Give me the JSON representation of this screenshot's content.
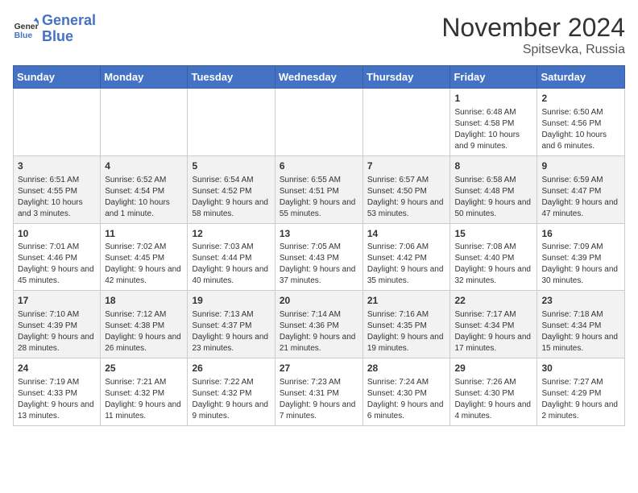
{
  "logo": {
    "general": "General",
    "blue": "Blue"
  },
  "header": {
    "month": "November 2024",
    "location": "Spitsevka, Russia"
  },
  "weekdays": [
    "Sunday",
    "Monday",
    "Tuesday",
    "Wednesday",
    "Thursday",
    "Friday",
    "Saturday"
  ],
  "rows": [
    [
      {
        "day": "",
        "info": ""
      },
      {
        "day": "",
        "info": ""
      },
      {
        "day": "",
        "info": ""
      },
      {
        "day": "",
        "info": ""
      },
      {
        "day": "",
        "info": ""
      },
      {
        "day": "1",
        "info": "Sunrise: 6:48 AM\nSunset: 4:58 PM\nDaylight: 10 hours and 9 minutes."
      },
      {
        "day": "2",
        "info": "Sunrise: 6:50 AM\nSunset: 4:56 PM\nDaylight: 10 hours and 6 minutes."
      }
    ],
    [
      {
        "day": "3",
        "info": "Sunrise: 6:51 AM\nSunset: 4:55 PM\nDaylight: 10 hours and 3 minutes."
      },
      {
        "day": "4",
        "info": "Sunrise: 6:52 AM\nSunset: 4:54 PM\nDaylight: 10 hours and 1 minute."
      },
      {
        "day": "5",
        "info": "Sunrise: 6:54 AM\nSunset: 4:52 PM\nDaylight: 9 hours and 58 minutes."
      },
      {
        "day": "6",
        "info": "Sunrise: 6:55 AM\nSunset: 4:51 PM\nDaylight: 9 hours and 55 minutes."
      },
      {
        "day": "7",
        "info": "Sunrise: 6:57 AM\nSunset: 4:50 PM\nDaylight: 9 hours and 53 minutes."
      },
      {
        "day": "8",
        "info": "Sunrise: 6:58 AM\nSunset: 4:48 PM\nDaylight: 9 hours and 50 minutes."
      },
      {
        "day": "9",
        "info": "Sunrise: 6:59 AM\nSunset: 4:47 PM\nDaylight: 9 hours and 47 minutes."
      }
    ],
    [
      {
        "day": "10",
        "info": "Sunrise: 7:01 AM\nSunset: 4:46 PM\nDaylight: 9 hours and 45 minutes."
      },
      {
        "day": "11",
        "info": "Sunrise: 7:02 AM\nSunset: 4:45 PM\nDaylight: 9 hours and 42 minutes."
      },
      {
        "day": "12",
        "info": "Sunrise: 7:03 AM\nSunset: 4:44 PM\nDaylight: 9 hours and 40 minutes."
      },
      {
        "day": "13",
        "info": "Sunrise: 7:05 AM\nSunset: 4:43 PM\nDaylight: 9 hours and 37 minutes."
      },
      {
        "day": "14",
        "info": "Sunrise: 7:06 AM\nSunset: 4:42 PM\nDaylight: 9 hours and 35 minutes."
      },
      {
        "day": "15",
        "info": "Sunrise: 7:08 AM\nSunset: 4:40 PM\nDaylight: 9 hours and 32 minutes."
      },
      {
        "day": "16",
        "info": "Sunrise: 7:09 AM\nSunset: 4:39 PM\nDaylight: 9 hours and 30 minutes."
      }
    ],
    [
      {
        "day": "17",
        "info": "Sunrise: 7:10 AM\nSunset: 4:39 PM\nDaylight: 9 hours and 28 minutes."
      },
      {
        "day": "18",
        "info": "Sunrise: 7:12 AM\nSunset: 4:38 PM\nDaylight: 9 hours and 26 minutes."
      },
      {
        "day": "19",
        "info": "Sunrise: 7:13 AM\nSunset: 4:37 PM\nDaylight: 9 hours and 23 minutes."
      },
      {
        "day": "20",
        "info": "Sunrise: 7:14 AM\nSunset: 4:36 PM\nDaylight: 9 hours and 21 minutes."
      },
      {
        "day": "21",
        "info": "Sunrise: 7:16 AM\nSunset: 4:35 PM\nDaylight: 9 hours and 19 minutes."
      },
      {
        "day": "22",
        "info": "Sunrise: 7:17 AM\nSunset: 4:34 PM\nDaylight: 9 hours and 17 minutes."
      },
      {
        "day": "23",
        "info": "Sunrise: 7:18 AM\nSunset: 4:34 PM\nDaylight: 9 hours and 15 minutes."
      }
    ],
    [
      {
        "day": "24",
        "info": "Sunrise: 7:19 AM\nSunset: 4:33 PM\nDaylight: 9 hours and 13 minutes."
      },
      {
        "day": "25",
        "info": "Sunrise: 7:21 AM\nSunset: 4:32 PM\nDaylight: 9 hours and 11 minutes."
      },
      {
        "day": "26",
        "info": "Sunrise: 7:22 AM\nSunset: 4:32 PM\nDaylight: 9 hours and 9 minutes."
      },
      {
        "day": "27",
        "info": "Sunrise: 7:23 AM\nSunset: 4:31 PM\nDaylight: 9 hours and 7 minutes."
      },
      {
        "day": "28",
        "info": "Sunrise: 7:24 AM\nSunset: 4:30 PM\nDaylight: 9 hours and 6 minutes."
      },
      {
        "day": "29",
        "info": "Sunrise: 7:26 AM\nSunset: 4:30 PM\nDaylight: 9 hours and 4 minutes."
      },
      {
        "day": "30",
        "info": "Sunrise: 7:27 AM\nSunset: 4:29 PM\nDaylight: 9 hours and 2 minutes."
      }
    ]
  ]
}
